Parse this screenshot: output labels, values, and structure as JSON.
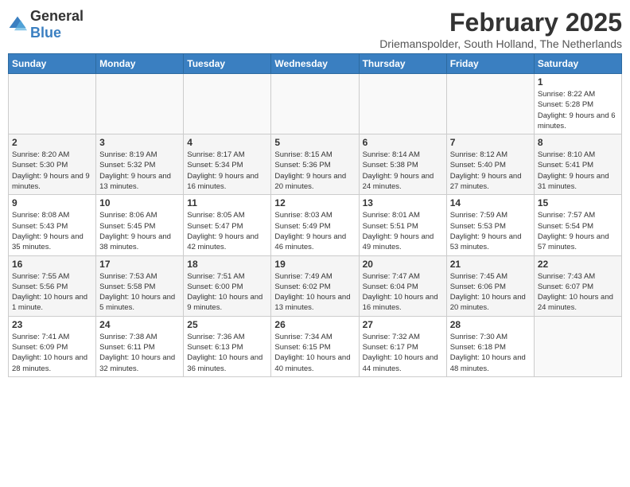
{
  "logo": {
    "general": "General",
    "blue": "Blue"
  },
  "title": "February 2025",
  "subtitle": "Driemanspolder, South Holland, The Netherlands",
  "headers": [
    "Sunday",
    "Monday",
    "Tuesday",
    "Wednesday",
    "Thursday",
    "Friday",
    "Saturday"
  ],
  "weeks": [
    [
      {
        "day": "",
        "info": ""
      },
      {
        "day": "",
        "info": ""
      },
      {
        "day": "",
        "info": ""
      },
      {
        "day": "",
        "info": ""
      },
      {
        "day": "",
        "info": ""
      },
      {
        "day": "",
        "info": ""
      },
      {
        "day": "1",
        "info": "Sunrise: 8:22 AM\nSunset: 5:28 PM\nDaylight: 9 hours and 6 minutes."
      }
    ],
    [
      {
        "day": "2",
        "info": "Sunrise: 8:20 AM\nSunset: 5:30 PM\nDaylight: 9 hours and 9 minutes."
      },
      {
        "day": "3",
        "info": "Sunrise: 8:19 AM\nSunset: 5:32 PM\nDaylight: 9 hours and 13 minutes."
      },
      {
        "day": "4",
        "info": "Sunrise: 8:17 AM\nSunset: 5:34 PM\nDaylight: 9 hours and 16 minutes."
      },
      {
        "day": "5",
        "info": "Sunrise: 8:15 AM\nSunset: 5:36 PM\nDaylight: 9 hours and 20 minutes."
      },
      {
        "day": "6",
        "info": "Sunrise: 8:14 AM\nSunset: 5:38 PM\nDaylight: 9 hours and 24 minutes."
      },
      {
        "day": "7",
        "info": "Sunrise: 8:12 AM\nSunset: 5:40 PM\nDaylight: 9 hours and 27 minutes."
      },
      {
        "day": "8",
        "info": "Sunrise: 8:10 AM\nSunset: 5:41 PM\nDaylight: 9 hours and 31 minutes."
      }
    ],
    [
      {
        "day": "9",
        "info": "Sunrise: 8:08 AM\nSunset: 5:43 PM\nDaylight: 9 hours and 35 minutes."
      },
      {
        "day": "10",
        "info": "Sunrise: 8:06 AM\nSunset: 5:45 PM\nDaylight: 9 hours and 38 minutes."
      },
      {
        "day": "11",
        "info": "Sunrise: 8:05 AM\nSunset: 5:47 PM\nDaylight: 9 hours and 42 minutes."
      },
      {
        "day": "12",
        "info": "Sunrise: 8:03 AM\nSunset: 5:49 PM\nDaylight: 9 hours and 46 minutes."
      },
      {
        "day": "13",
        "info": "Sunrise: 8:01 AM\nSunset: 5:51 PM\nDaylight: 9 hours and 49 minutes."
      },
      {
        "day": "14",
        "info": "Sunrise: 7:59 AM\nSunset: 5:53 PM\nDaylight: 9 hours and 53 minutes."
      },
      {
        "day": "15",
        "info": "Sunrise: 7:57 AM\nSunset: 5:54 PM\nDaylight: 9 hours and 57 minutes."
      }
    ],
    [
      {
        "day": "16",
        "info": "Sunrise: 7:55 AM\nSunset: 5:56 PM\nDaylight: 10 hours and 1 minute."
      },
      {
        "day": "17",
        "info": "Sunrise: 7:53 AM\nSunset: 5:58 PM\nDaylight: 10 hours and 5 minutes."
      },
      {
        "day": "18",
        "info": "Sunrise: 7:51 AM\nSunset: 6:00 PM\nDaylight: 10 hours and 9 minutes."
      },
      {
        "day": "19",
        "info": "Sunrise: 7:49 AM\nSunset: 6:02 PM\nDaylight: 10 hours and 13 minutes."
      },
      {
        "day": "20",
        "info": "Sunrise: 7:47 AM\nSunset: 6:04 PM\nDaylight: 10 hours and 16 minutes."
      },
      {
        "day": "21",
        "info": "Sunrise: 7:45 AM\nSunset: 6:06 PM\nDaylight: 10 hours and 20 minutes."
      },
      {
        "day": "22",
        "info": "Sunrise: 7:43 AM\nSunset: 6:07 PM\nDaylight: 10 hours and 24 minutes."
      }
    ],
    [
      {
        "day": "23",
        "info": "Sunrise: 7:41 AM\nSunset: 6:09 PM\nDaylight: 10 hours and 28 minutes."
      },
      {
        "day": "24",
        "info": "Sunrise: 7:38 AM\nSunset: 6:11 PM\nDaylight: 10 hours and 32 minutes."
      },
      {
        "day": "25",
        "info": "Sunrise: 7:36 AM\nSunset: 6:13 PM\nDaylight: 10 hours and 36 minutes."
      },
      {
        "day": "26",
        "info": "Sunrise: 7:34 AM\nSunset: 6:15 PM\nDaylight: 10 hours and 40 minutes."
      },
      {
        "day": "27",
        "info": "Sunrise: 7:32 AM\nSunset: 6:17 PM\nDaylight: 10 hours and 44 minutes."
      },
      {
        "day": "28",
        "info": "Sunrise: 7:30 AM\nSunset: 6:18 PM\nDaylight: 10 hours and 48 minutes."
      },
      {
        "day": "",
        "info": ""
      }
    ]
  ]
}
